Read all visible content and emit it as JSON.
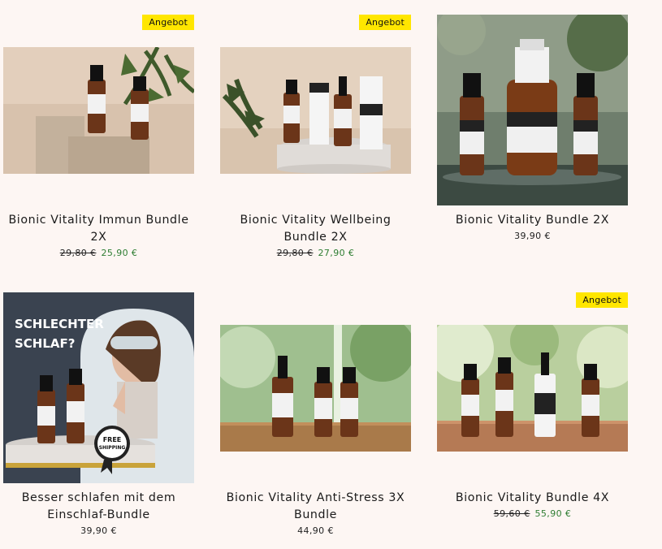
{
  "products": [
    {
      "title": "Bionic Vitality Immun Bundle 2X",
      "badge": "Angebot",
      "old_price": "29,80 €",
      "price": "25,90 €"
    },
    {
      "title": "Bionic Vitality Wellbeing Bundle 2X",
      "badge": "Angebot",
      "old_price": "29,80 €",
      "price": "27,90 €"
    },
    {
      "title": "Bionic Vitality Bundle 2X",
      "badge": "",
      "old_price": "",
      "price": "39,90 €"
    },
    {
      "title": "Besser schlafen mit dem Einschlaf-Bundle",
      "badge": "",
      "old_price": "",
      "price": "39,90 €",
      "promo": {
        "headline_1": "SCHLECHTER",
        "headline_2": "SCHLAF?",
        "seal_1": "FREE",
        "seal_2": "SHIPPING"
      }
    },
    {
      "title": "Bionic Vitality Anti-Stress 3X Bundle",
      "badge": "",
      "old_price": "",
      "price": "44,90 €"
    },
    {
      "title": "Bionic Vitality Bundle 4X",
      "badge": "Angebot",
      "old_price": "59,60 €",
      "price": "55,90 €"
    }
  ]
}
